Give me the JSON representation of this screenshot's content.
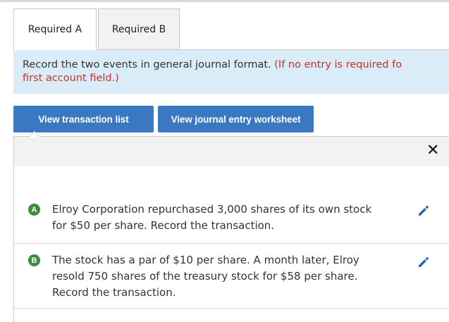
{
  "tabs": [
    {
      "label": "Required A",
      "active": true
    },
    {
      "label": "Required B",
      "active": false
    }
  ],
  "instruction": {
    "text": "Record the two events in general journal format.",
    "note_line1": "(If no entry is required fo",
    "line2": "first account field.)"
  },
  "buttons": {
    "transaction_list": "View transaction list",
    "journal_worksheet": "View journal entry worksheet"
  },
  "panel": {
    "close_glyph": "✕",
    "transactions": [
      {
        "badge": "A",
        "text": "Elroy Corporation repurchased 3,000 shares of its own stock for $50 per share. Record the transaction."
      },
      {
        "badge": "B",
        "text": "The stock has a par of $10 per share. A month later, Elroy resold 750 shares of the treasury stock for $58 per share. Record the transaction."
      }
    ]
  },
  "colors": {
    "accent": "#3a78c2",
    "badge": "#3c8c3c",
    "instruction_bg": "#d9ecf8",
    "note_red": "#c9302c"
  },
  "icons": {
    "edit": "pencil-icon",
    "close": "close-icon"
  }
}
